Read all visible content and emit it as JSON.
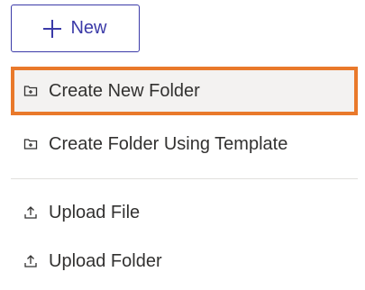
{
  "new_button": {
    "label": "New",
    "icon": "plus-icon"
  },
  "menu": {
    "items": [
      {
        "label": "Create New Folder",
        "icon": "folder-plus-icon",
        "highlighted": true
      },
      {
        "label": "Create Folder Using Template",
        "icon": "folder-plus-icon"
      },
      {
        "label": "Upload File",
        "icon": "upload-icon"
      },
      {
        "label": "Upload Folder",
        "icon": "upload-icon"
      }
    ]
  },
  "colors": {
    "accent": "#3b3aa8",
    "highlight_border": "#e9792b",
    "text": "#323130",
    "hover_bg": "#f3f2f1"
  }
}
